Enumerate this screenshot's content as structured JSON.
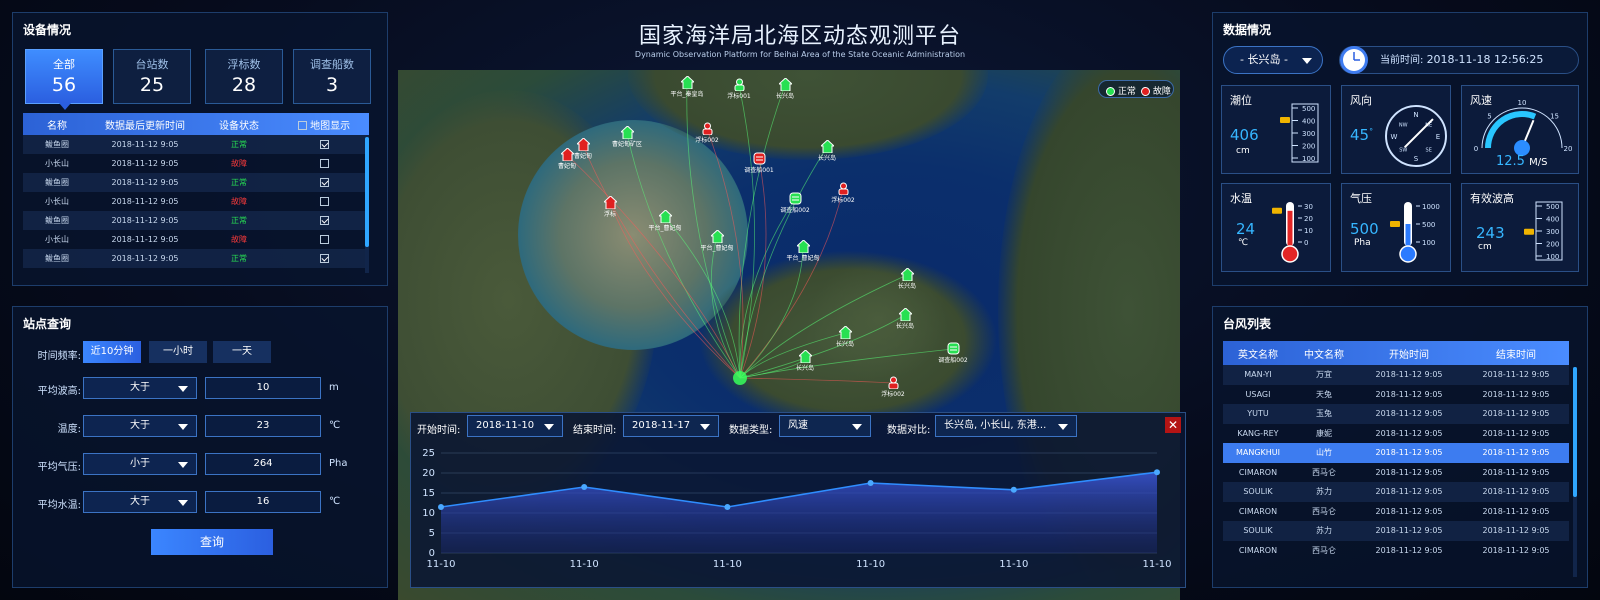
{
  "header": {
    "title": "国家海洋局北海区动态观测平台",
    "subtitle": "Dynamic Observation Platform for Beihai Area of the State Oceanic Administration"
  },
  "device": {
    "title": "设备情况",
    "cards": [
      {
        "label": "全部",
        "value": "56"
      },
      {
        "label": "台站数",
        "value": "25"
      },
      {
        "label": "浮标数",
        "value": "28"
      },
      {
        "label": "调查船数",
        "value": "3"
      }
    ],
    "columns": [
      "名称",
      "数据最后更新时间",
      "设备状态",
      "地图显示"
    ],
    "rows": [
      {
        "name": "鲅鱼圈",
        "time": "2018-11-12 9:05",
        "status": "正常",
        "ok": true,
        "show": true
      },
      {
        "name": "小长山",
        "time": "2018-11-12 9:05",
        "status": "故障",
        "ok": false,
        "show": false
      },
      {
        "name": "鲅鱼圈",
        "time": "2018-11-12 9:05",
        "status": "正常",
        "ok": true,
        "show": true
      },
      {
        "name": "小长山",
        "time": "2018-11-12 9:05",
        "status": "故障",
        "ok": false,
        "show": false
      },
      {
        "name": "鲅鱼圈",
        "time": "2018-11-12 9:05",
        "status": "正常",
        "ok": true,
        "show": true
      },
      {
        "name": "小长山",
        "time": "2018-11-12 9:05",
        "status": "故障",
        "ok": false,
        "show": false
      },
      {
        "name": "鲅鱼圈",
        "time": "2018-11-12 9:05",
        "status": "正常",
        "ok": true,
        "show": true
      }
    ]
  },
  "query": {
    "title": "站点查询",
    "freq_label": "时间频率:",
    "freq_options": [
      "近10分钟",
      "一小时",
      "一天"
    ],
    "fields": [
      {
        "label": "平均波高:",
        "op": "大于",
        "value": "10",
        "unit": "m"
      },
      {
        "label": "温度:",
        "op": "大于",
        "value": "23",
        "unit": "℃"
      },
      {
        "label": "平均气压:",
        "op": "小于",
        "value": "264",
        "unit": "Pha"
      },
      {
        "label": "平均水温:",
        "op": "大于",
        "value": "16",
        "unit": "℃"
      }
    ],
    "submit": "查询"
  },
  "map": {
    "legend": {
      "normal": "正常",
      "fault": "故障"
    },
    "markers": [
      {
        "label": "平台_秦皇岛",
        "type": "station",
        "ok": true
      },
      {
        "label": "浮标001",
        "type": "buoy",
        "ok": true
      },
      {
        "label": "长兴岛",
        "type": "station",
        "ok": true
      },
      {
        "label": "浮标002",
        "type": "buoy",
        "ok": false
      },
      {
        "label": "曹妃甸矿区",
        "type": "station",
        "ok": true
      },
      {
        "label": "调查船001",
        "type": "ship",
        "ok": false
      },
      {
        "label": "长兴岛",
        "type": "station",
        "ok": true
      },
      {
        "label": "浮标002",
        "type": "buoy",
        "ok": false
      },
      {
        "label": "调查船002",
        "type": "ship",
        "ok": true
      },
      {
        "label": "平台_曹妃甸",
        "type": "station",
        "ok": true
      },
      {
        "label": "平台_曹妃甸",
        "type": "station",
        "ok": true
      },
      {
        "label": "平台_曹妃甸",
        "type": "station",
        "ok": true
      },
      {
        "label": "长兴岛",
        "type": "station",
        "ok": true
      },
      {
        "label": "长兴岛",
        "type": "station",
        "ok": true
      },
      {
        "label": "长兴岛",
        "type": "station",
        "ok": true
      },
      {
        "label": "长兴岛",
        "type": "station",
        "ok": true
      },
      {
        "label": "调查船002",
        "type": "ship",
        "ok": true
      },
      {
        "label": "浮标002",
        "type": "buoy",
        "ok": false
      },
      {
        "label": "曹妃甸",
        "type": "station",
        "ok": false
      },
      {
        "label": "曹妃甸",
        "type": "station",
        "ok": false
      },
      {
        "label": "浮标",
        "type": "station",
        "ok": false
      }
    ]
  },
  "chart_panel": {
    "start_label": "开始时间:",
    "start_value": "2018-11-10",
    "end_label": "结束时间:",
    "end_value": "2018-11-17",
    "type_label": "数据类型:",
    "type_value": "风速",
    "compare_label": "数据对比:",
    "compare_value": "长兴岛, 小长山, 东港...",
    "close": "✕"
  },
  "chart_data": {
    "type": "area",
    "categories": [
      "11-10",
      "11-10",
      "11-10",
      "11-10",
      "11-10",
      "11-10"
    ],
    "x_positions": [
      0,
      0.2,
      0.4,
      0.6,
      0.8,
      1.0
    ],
    "points": [
      [
        0,
        11.5
      ],
      [
        0.2,
        16.5
      ],
      [
        0.4,
        11.5
      ],
      [
        0.6,
        17.5
      ],
      [
        0.8,
        15.8
      ],
      [
        1.0,
        20.2
      ]
    ],
    "yticks": [
      0,
      5,
      10,
      15,
      20,
      25
    ],
    "ylim": [
      0,
      25
    ],
    "grid": true,
    "color": "#2f8dff"
  },
  "data": {
    "title": "数据情况",
    "location": "- 长兴岛 -",
    "time_label": "当前时间:",
    "time_value": "2018-11-18 12:56:25",
    "tide": {
      "label": "潮位",
      "value": "406",
      "unit": "cm",
      "ticks": [
        "500",
        "400",
        "300",
        "200",
        "100"
      ]
    },
    "wind_dir": {
      "label": "风向",
      "value": "45",
      "unit": "°",
      "dirs": [
        "N",
        "NE",
        "E",
        "SE",
        "S",
        "SW",
        "W",
        "NW"
      ],
      "level": 45
    },
    "wind_speed": {
      "label": "风速",
      "value": "12.5",
      "unit": "M/S",
      "ticks": [
        "0",
        "5",
        "10",
        "15",
        "20"
      ],
      "level": 0.625
    },
    "water_temp": {
      "label": "水温",
      "value": "24",
      "unit": "℃",
      "ticks": [
        "30",
        "20",
        "10",
        "0"
      ],
      "level": 0.8
    },
    "pressure": {
      "label": "气压",
      "value": "500",
      "unit": "Pha",
      "ticks": [
        "1000",
        "500",
        "100"
      ],
      "level": 0.5
    },
    "wave": {
      "label": "有效波高",
      "value": "243",
      "unit": "cm",
      "ticks": [
        "500",
        "400",
        "300",
        "200",
        "100"
      ],
      "level": 0.486
    }
  },
  "typhoon": {
    "title": "台风列表",
    "columns": [
      "英文名称",
      "中文名称",
      "开始时间",
      "结束时间"
    ],
    "rows": [
      [
        "MAN-YI",
        "万宜",
        "2018-11-12 9:05",
        "2018-11-12 9:05"
      ],
      [
        "USAGI",
        "天兔",
        "2018-11-12 9:05",
        "2018-11-12 9:05"
      ],
      [
        "YUTU",
        "玉兔",
        "2018-11-12 9:05",
        "2018-11-12 9:05"
      ],
      [
        "KANG-REY",
        "康妮",
        "2018-11-12 9:05",
        "2018-11-12 9:05"
      ],
      [
        "MANGKHUI",
        "山竹",
        "2018-11-12 9:05",
        "2018-11-12 9:05"
      ],
      [
        "CIMARON",
        "西马仑",
        "2018-11-12 9:05",
        "2018-11-12 9:05"
      ],
      [
        "SOULIK",
        "苏力",
        "2018-11-12 9:05",
        "2018-11-12 9:05"
      ],
      [
        "CIMARON",
        "西马仑",
        "2018-11-12 9:05",
        "2018-11-12 9:05"
      ],
      [
        "SOULIK",
        "苏力",
        "2018-11-12 9:05",
        "2018-11-12 9:05"
      ],
      [
        "CIMARON",
        "西马仑",
        "2018-11-12 9:05",
        "2018-11-12 9:05"
      ]
    ],
    "highlight_row": 4
  }
}
